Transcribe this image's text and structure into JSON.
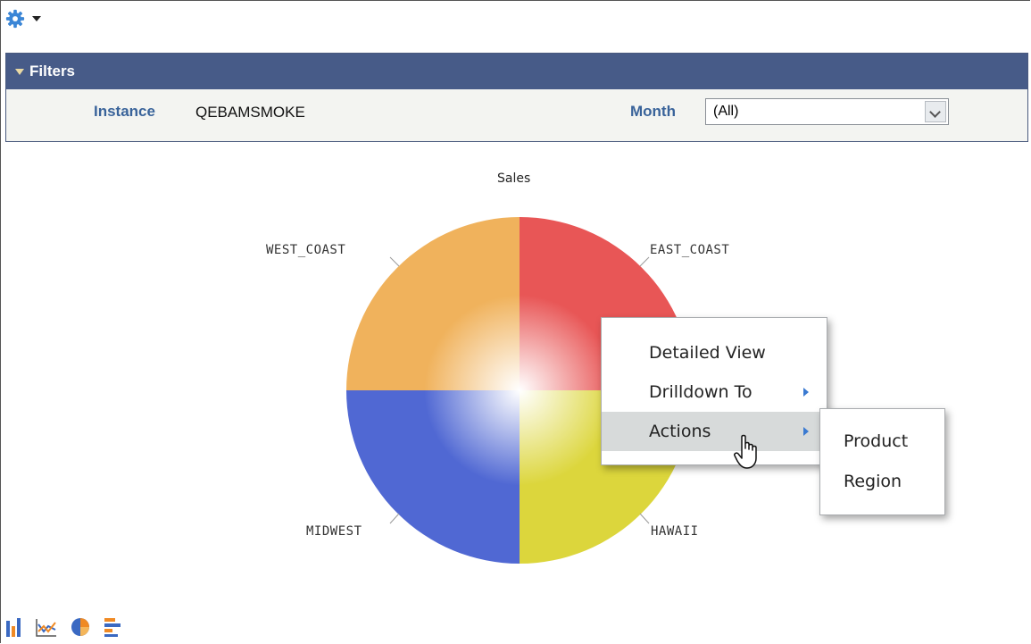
{
  "toolbar": {
    "settings_icon": "gear-icon",
    "menu_caret": "chevron-down-icon"
  },
  "filters": {
    "title": "Filters",
    "instance": {
      "label": "Instance",
      "value": "QEBAMSMOKE"
    },
    "month": {
      "label": "Month",
      "selected": "(All)"
    }
  },
  "chart_data": {
    "type": "pie",
    "title": "Sales",
    "slices": [
      {
        "label": "EAST_COAST",
        "value": 25,
        "color": "#e85656"
      },
      {
        "label": "HAWAII",
        "value": 25,
        "color": "#dcd63c"
      },
      {
        "label": "MIDWEST",
        "value": 25,
        "color": "#5068d3"
      },
      {
        "label": "WEST_COAST",
        "value": 25,
        "color": "#f0b25c"
      }
    ]
  },
  "context_menu": {
    "items": [
      {
        "label": "Detailed View",
        "has_submenu": false
      },
      {
        "label": "Drilldown To",
        "has_submenu": true
      },
      {
        "label": "Actions",
        "has_submenu": true,
        "active": true
      }
    ],
    "submenu": [
      {
        "label": "Product"
      },
      {
        "label": "Region"
      }
    ]
  },
  "chart_type_icons": [
    "bar-chart-icon",
    "line-chart-icon",
    "pie-chart-icon",
    "horizontal-bar-chart-icon"
  ],
  "colors": {
    "header": "#475b88",
    "label": "#39639a",
    "accent": "#3a7ad1"
  }
}
